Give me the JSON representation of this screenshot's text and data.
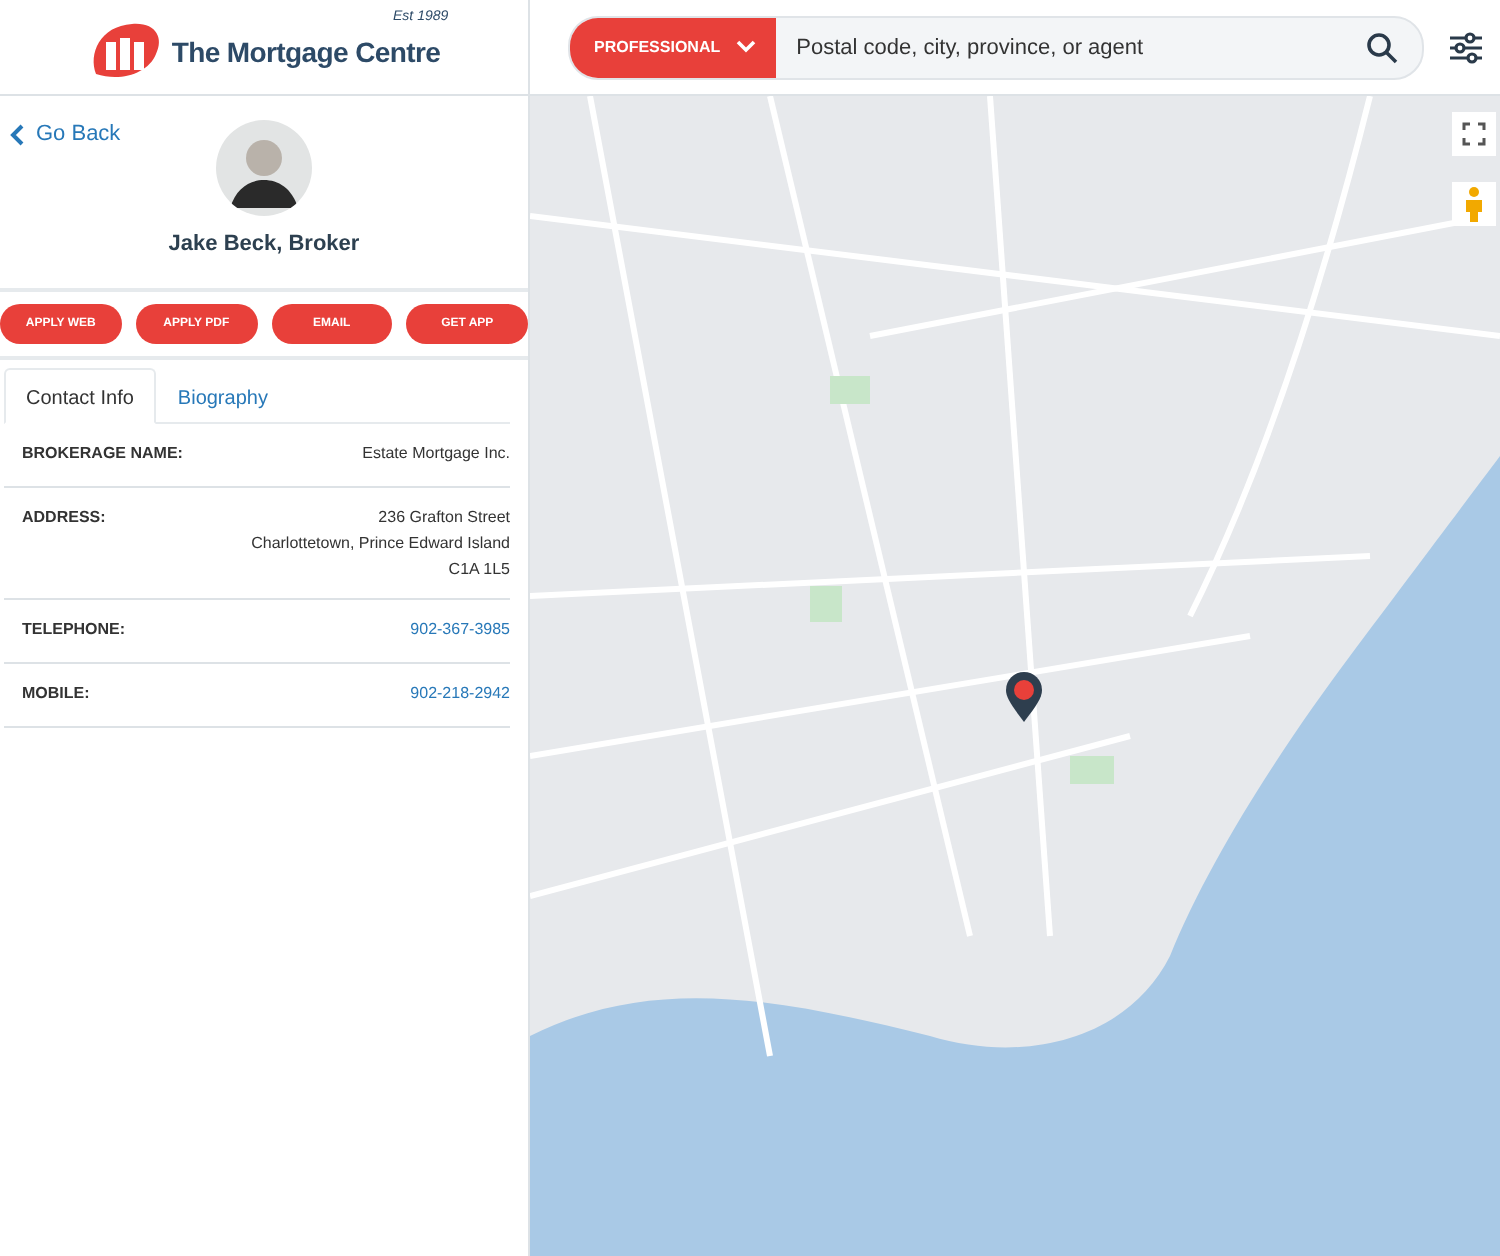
{
  "logo": {
    "name": "The Mortgage Centre",
    "established": "Est 1989"
  },
  "search": {
    "category": "PROFESSIONAL",
    "placeholder": "Postal code, city, province, or agent"
  },
  "profile": {
    "back_link": "Go Back",
    "name": "Jake Beck, Broker"
  },
  "actions": [
    "APPLY WEB",
    "APPLY PDF",
    "EMAIL",
    "GET APP"
  ],
  "tabs": [
    {
      "label": "Contact Info",
      "selected": true
    },
    {
      "label": "Biography",
      "selected": false
    }
  ],
  "details": [
    {
      "label": "BROKERAGE NAME:",
      "lines": [
        "Estate Mortgage Inc."
      ],
      "kind": "text"
    },
    {
      "label": "ADDRESS:",
      "lines": [
        "236 Grafton Street",
        "Charlottetown, Prince Edward Island",
        "C1A 1L5"
      ],
      "kind": "text"
    },
    {
      "label": "TELEPHONE:",
      "lines": [
        "902-367-3985"
      ],
      "kind": "link"
    },
    {
      "label": "MOBILE:",
      "lines": [
        "902-218-2942"
      ],
      "kind": "link"
    }
  ]
}
